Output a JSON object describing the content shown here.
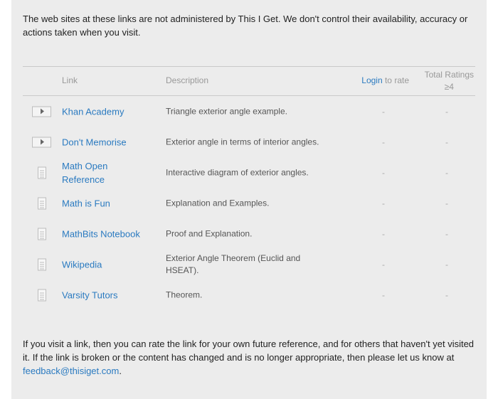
{
  "intro": "The web sites at these links are not administered by This I Get. We don't control their availability, accuracy or actions taken when you visit.",
  "table": {
    "headers": {
      "link": "Link",
      "description": "Description",
      "login": "Login",
      "rate_suffix": " to rate",
      "total_line1": "Total Ratings",
      "total_line2": "≥4"
    },
    "rows": [
      {
        "icon": "play-icon",
        "link": "Khan Academy",
        "description": "Triangle exterior angle example.",
        "rating": "-",
        "total": "-"
      },
      {
        "icon": "play-icon",
        "link": "Don't Memorise",
        "description": "Exterior angle in terms of interior angles.",
        "rating": "-",
        "total": "-"
      },
      {
        "icon": "document-icon",
        "link": "Math Open Reference",
        "description": "Interactive diagram of exterior angles.",
        "rating": "-",
        "total": "-"
      },
      {
        "icon": "document-icon",
        "link": "Math is Fun",
        "description": "Explanation and Examples.",
        "rating": "-",
        "total": "-"
      },
      {
        "icon": "document-icon",
        "link": "MathBits Notebook",
        "description": "Proof and Explanation.",
        "rating": "-",
        "total": "-"
      },
      {
        "icon": "document-icon",
        "link": "Wikipedia",
        "description": "Exterior Angle Theorem (Euclid and HSEAT).",
        "rating": "-",
        "total": "-"
      },
      {
        "icon": "document-icon",
        "link": "Varsity Tutors",
        "description": "Theorem.",
        "rating": "-",
        "total": "-"
      }
    ]
  },
  "outro": {
    "text": "If you visit a link, then you can rate the link for your own future reference, and for others that haven't yet visited it. If the link is broken or the content has changed and is no longer appropriate, then please let us know at ",
    "email": "feedback@thisiget.com",
    "end": "."
  },
  "colors": {
    "panel_bg": "#ececec",
    "link": "#2a7ac0",
    "muted": "#999999"
  }
}
